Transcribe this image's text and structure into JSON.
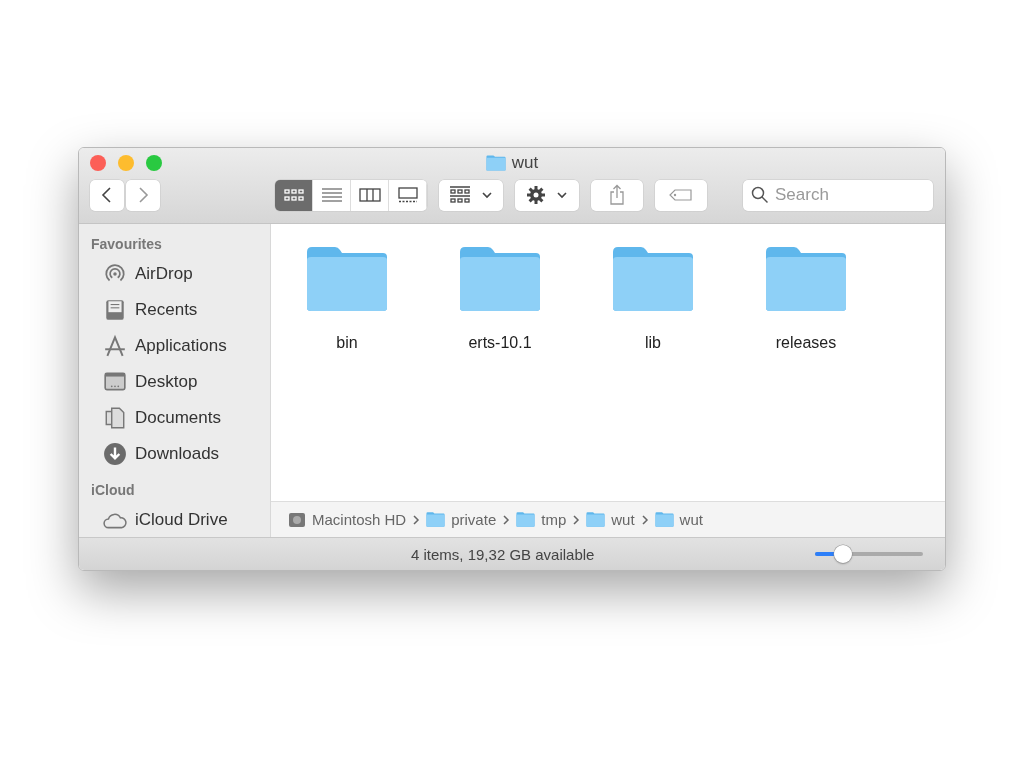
{
  "window": {
    "title": "wut"
  },
  "toolbar": {
    "view_modes": [
      {
        "selected": true
      },
      {
        "selected": false
      },
      {
        "selected": false
      },
      {
        "selected": false
      }
    ],
    "search": {
      "placeholder": "Search"
    }
  },
  "sidebar": {
    "sections": [
      {
        "heading": "Favourites",
        "items": [
          "AirDrop",
          "Recents",
          "Applications",
          "Desktop",
          "Documents",
          "Downloads"
        ]
      },
      {
        "heading": "iCloud",
        "items": [
          "iCloud Drive"
        ]
      }
    ]
  },
  "files": [
    {
      "name": "bin"
    },
    {
      "name": "erts-10.1"
    },
    {
      "name": "lib"
    },
    {
      "name": "releases"
    }
  ],
  "path_bar": [
    {
      "kind": "disk",
      "label": "Macintosh HD"
    },
    {
      "kind": "folder",
      "label": "private"
    },
    {
      "kind": "folder",
      "label": "tmp"
    },
    {
      "kind": "folder",
      "label": "wut"
    },
    {
      "kind": "folder",
      "label": "wut"
    }
  ],
  "status_bar": {
    "text": "4 items, 19,32 GB available",
    "icon_size": {
      "level": 0.26
    }
  }
}
